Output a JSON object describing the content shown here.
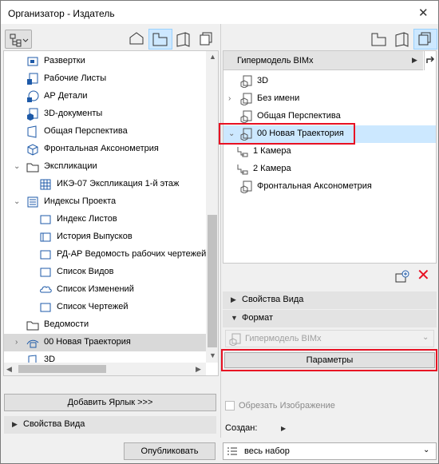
{
  "window": {
    "title": "Организатор - Издатель"
  },
  "left_tree": {
    "items": [
      {
        "label": "Развертки",
        "icon": "elevation-icon"
      },
      {
        "label": "Рабочие Листы",
        "icon": "worksheet-icon"
      },
      {
        "label": "АР Детали",
        "icon": "detail-icon"
      },
      {
        "label": "3D-документы",
        "icon": "3d-document-icon"
      },
      {
        "label": "Общая Перспектива",
        "icon": "perspective-icon"
      },
      {
        "label": "Фронтальная Аксонометрия",
        "icon": "axonometry-icon"
      },
      {
        "label": "Экспликации",
        "icon": "folder-icon"
      },
      {
        "label": "ИКЭ-07 Экспликация 1-й этаж",
        "icon": "schedule-icon"
      },
      {
        "label": "Индексы Проекта",
        "icon": "index-icon"
      },
      {
        "label": "Индекс Листов",
        "icon": "index-item-icon"
      },
      {
        "label": "История Выпусков",
        "icon": "index-item-icon"
      },
      {
        "label": "РД-АР Ведомость рабочих чертежей",
        "icon": "index-item-icon"
      },
      {
        "label": "Список Видов",
        "icon": "index-item-icon"
      },
      {
        "label": "Список Изменений",
        "icon": "cloud-icon"
      },
      {
        "label": "Список Чертежей",
        "icon": "index-item-icon"
      },
      {
        "label": "Ведомости",
        "icon": "folder-icon"
      },
      {
        "label": "00 Новая Траектория",
        "icon": "camera-path-icon"
      },
      {
        "label": "3D",
        "icon": "3d-icon"
      }
    ]
  },
  "left_bottom": {
    "add_shortcut": "Добавить Ярлык >>>",
    "view_properties": "Свойства Вида",
    "publish": "Опубликовать"
  },
  "right_header": {
    "label": "Гипермодель BIMx"
  },
  "right_tree": {
    "items": [
      {
        "label": "3D"
      },
      {
        "label": "Без имени"
      },
      {
        "label": "Общая Перспектива"
      },
      {
        "label": "00 Новая Траектория"
      },
      {
        "label": "1 Камера"
      },
      {
        "label": "2 Камера"
      },
      {
        "label": "Фронтальная Аксонометрия"
      }
    ]
  },
  "right_panel": {
    "view_properties": "Свойства Вида",
    "format": "Формат",
    "format_value": "Гипермодель BIMx",
    "params": "Параметры",
    "crop": "Обрезать Изображение",
    "created": "Создан:",
    "set_select": "весь набор"
  },
  "colors": {
    "selection": "#cce8ff",
    "highlight_box": "#e81123",
    "icon_blue": "#1e5aa8"
  }
}
